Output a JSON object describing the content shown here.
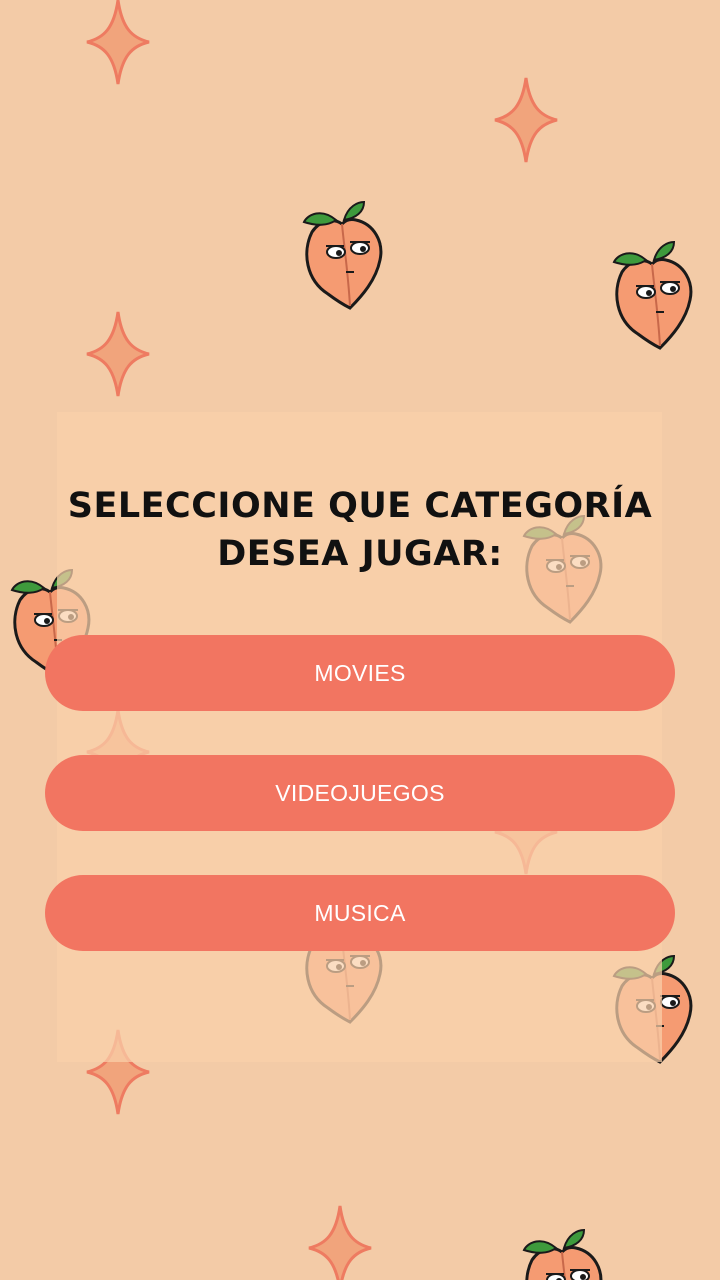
{
  "theme": {
    "background": "#F3CBA7",
    "panel": "#FAD0AA",
    "button": "#F27561",
    "button_text": "#FFFFFF",
    "sparkle_fill": "#F1A47C",
    "sparkle_stroke": "#EE7B61",
    "peach_fill": "#F59B72",
    "leaf": "#3E9A3C"
  },
  "header": {
    "title_line1": "SELECCIONE QUE CATEGORÍA",
    "title_line2": "DESEA JUGAR:"
  },
  "categories": {
    "movies": "MOVIES",
    "videojuegos": "VIDEOJUEGOS",
    "musica": "MUSICA"
  },
  "decorations": {
    "icons": [
      "sparkle-icon",
      "peach-icon"
    ]
  }
}
